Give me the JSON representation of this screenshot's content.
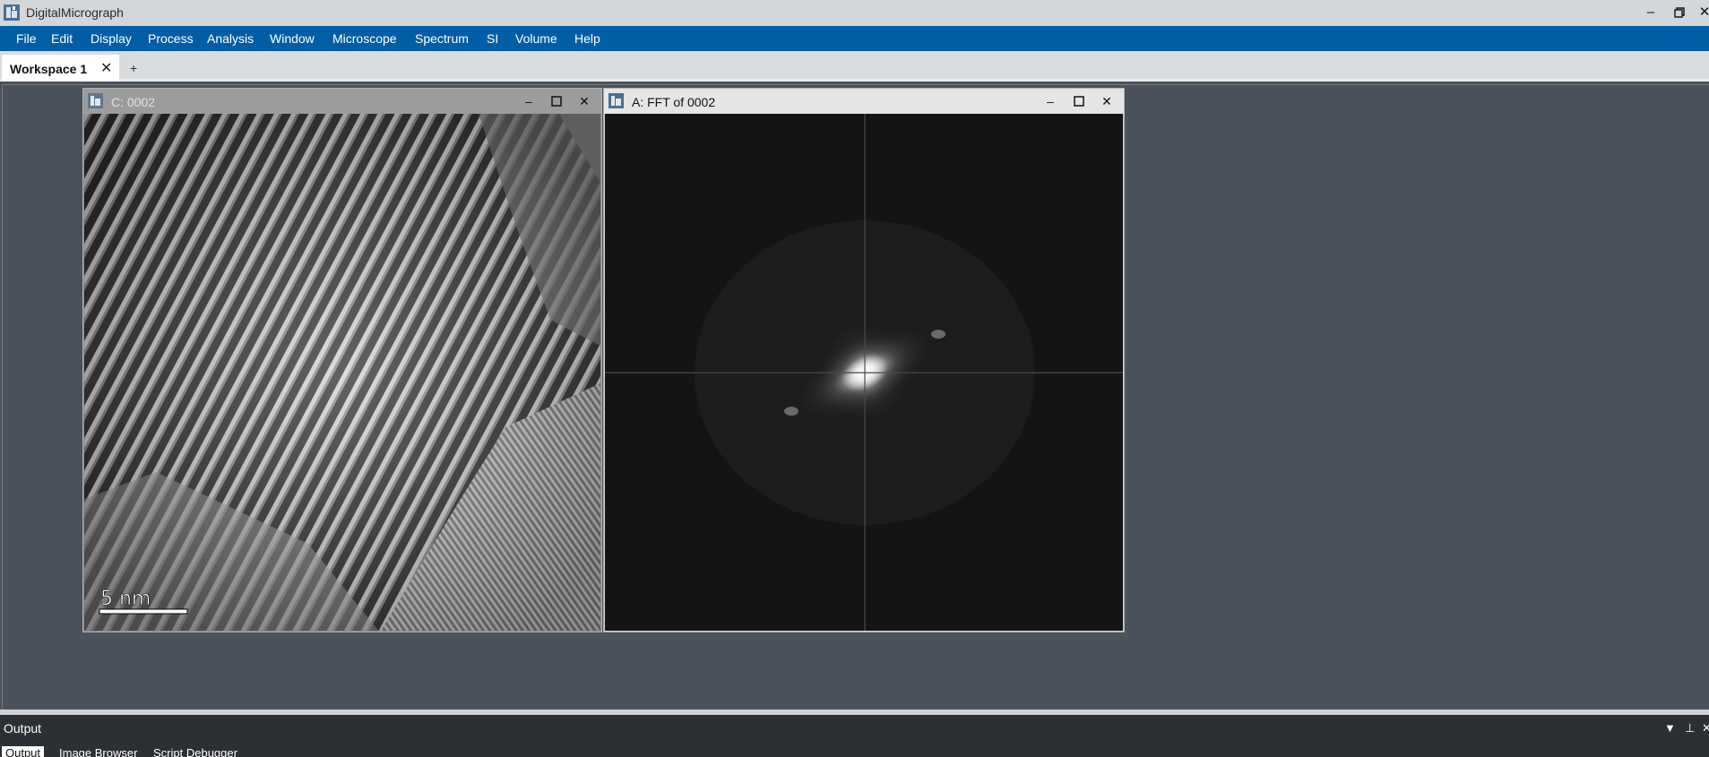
{
  "app": {
    "title": "DigitalMicrograph",
    "minimize_icon": "minimize-icon",
    "restore_icon": "restore-icon",
    "close_icon": "close-icon"
  },
  "menu": {
    "items": [
      "File",
      "Edit",
      "Display",
      "Process",
      "Analysis",
      "Window",
      "Microscope",
      "Spectrum",
      "SI",
      "Volume",
      "Help"
    ]
  },
  "tabs": {
    "workspace_label": "Workspace 1",
    "add_label": "+"
  },
  "windows": {
    "c": {
      "title": "C: 0002",
      "scale_bar_label": "5  nm"
    },
    "a": {
      "title": "A: FFT of 0002"
    }
  },
  "output": {
    "title": "Output",
    "tabs": [
      "Output",
      "Image Browser",
      "Script Debugger"
    ],
    "active_tab": 0
  },
  "colors": {
    "menubar": "#005ea6",
    "workspace_bg": "#4a525b",
    "titlebar": "#d4d7da"
  }
}
